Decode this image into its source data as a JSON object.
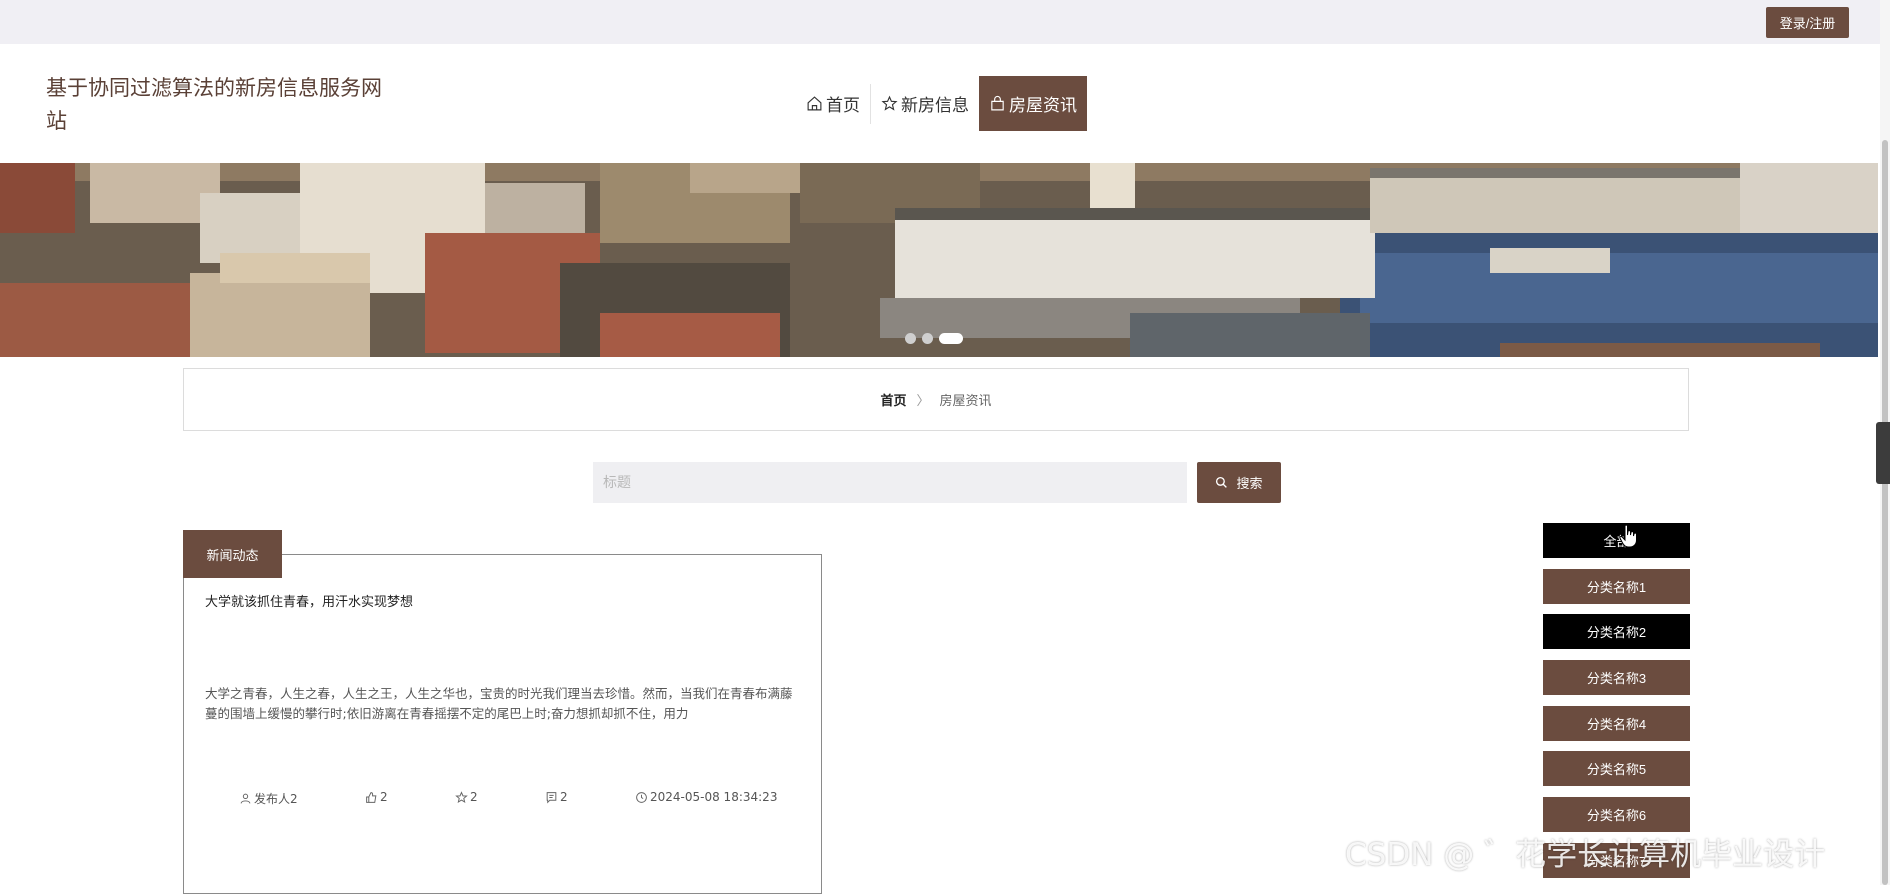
{
  "header": {
    "login_label": "登录/注册",
    "site_title": "基于协同过滤算法的新房信息服务网站"
  },
  "nav": {
    "items": [
      {
        "label": "首页",
        "icon": "home-icon"
      },
      {
        "label": "新房信息",
        "icon": "star-icon"
      },
      {
        "label": "房屋资讯",
        "icon": "bag-icon",
        "active": true
      }
    ]
  },
  "banner": {
    "slide_count": 3,
    "active_slide": 3
  },
  "breadcrumb": {
    "home": "首页",
    "separator": "〉",
    "current": "房屋资讯"
  },
  "search": {
    "placeholder": "标题",
    "button_label": "搜索"
  },
  "news": {
    "section_label": "新闻动态",
    "items": [
      {
        "title": "大学就该抓住青春，用汗水实现梦想",
        "summary": "大学之青春，人生之春，人生之王，人生之华也，宝贵的时光我们理当去珍惜。然而，当我们在青春布满藤蔓的围墙上缓慢的攀行时;依旧游离在青春摇摆不定的尾巴上时;奋力想抓却抓不住，用力",
        "author": "发布人2",
        "likes": "2",
        "favorites": "2",
        "comments": "2",
        "time": "2024-05-08 18:34:23"
      }
    ]
  },
  "categories": [
    {
      "label": "全部"
    },
    {
      "label": "分类名称1"
    },
    {
      "label": "分类名称2"
    },
    {
      "label": "分类名称3"
    },
    {
      "label": "分类名称4"
    },
    {
      "label": "分类名称5"
    },
    {
      "label": "分类名称6"
    },
    {
      "label": "分类名称7"
    }
  ],
  "watermark": "CSDN @ ゛花学长计算机毕业设计",
  "colors": {
    "brand": "#6b4c3f",
    "topbar": "#f0eff4",
    "category_selected": "#000000"
  }
}
